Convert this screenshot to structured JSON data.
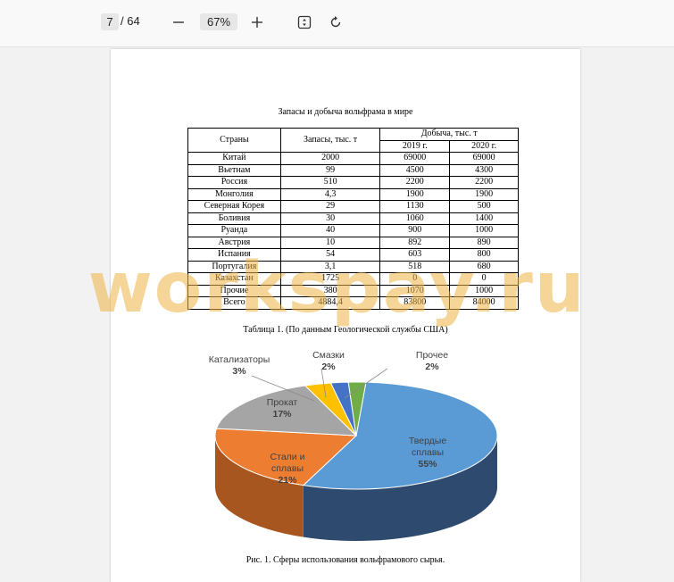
{
  "toolbar": {
    "page_current": "7",
    "page_total": "/ 64",
    "zoom": "67%"
  },
  "document": {
    "table_title": "Запасы и добыча вольфрама в мире",
    "headers": {
      "country": "Страны",
      "reserves": "Запасы, тыс. т",
      "production": "Добыча, тыс. т",
      "y2019": "2019 г.",
      "y2020": "2020 г."
    },
    "rows": [
      {
        "country": "Китай",
        "reserves": "2000",
        "y2019": "69000",
        "y2020": "69000"
      },
      {
        "country": "Вьетнам",
        "reserves": "99",
        "y2019": "4500",
        "y2020": "4300"
      },
      {
        "country": "Россия",
        "reserves": "510",
        "y2019": "2200",
        "y2020": "2200"
      },
      {
        "country": "Монголия",
        "reserves": "4,3",
        "y2019": "1900",
        "y2020": "1900"
      },
      {
        "country": "Северная Корея",
        "reserves": "29",
        "y2019": "1130",
        "y2020": "500"
      },
      {
        "country": "Боливия",
        "reserves": "30",
        "y2019": "1060",
        "y2020": "1400"
      },
      {
        "country": "Руанда",
        "reserves": "40",
        "y2019": "900",
        "y2020": "1000"
      },
      {
        "country": "Австрия",
        "reserves": "10",
        "y2019": "892",
        "y2020": "890"
      },
      {
        "country": "Испания",
        "reserves": "54",
        "y2019": "603",
        "y2020": "800"
      },
      {
        "country": "Португалия",
        "reserves": "3,1",
        "y2019": "518",
        "y2020": "680"
      },
      {
        "country": "Казахстан",
        "reserves": "1725",
        "y2019": "0",
        "y2020": "0"
      },
      {
        "country": "Прочие",
        "reserves": "380",
        "y2019": "1070",
        "y2020": "1000"
      },
      {
        "country": "Всего",
        "reserves": "4884,4",
        "y2019": "83800",
        "y2020": "84000"
      }
    ],
    "table_caption": "Таблица 1. (По данным Геологической службы США)",
    "figure_caption": "Рис. 1. Сферы использования вольфрамового сырья.",
    "watermark": "workspay.ru"
  },
  "chart_data": {
    "type": "pie",
    "style": "3d",
    "slices": [
      {
        "label": "Твердые сплавы",
        "value": 55,
        "pct": "55%",
        "color": "#5b9bd5",
        "side": "#2e4a6e"
      },
      {
        "label": "Стали и сплавы",
        "value": 21,
        "pct": "21%",
        "color": "#ed7d31",
        "side": "#a8561f"
      },
      {
        "label": "Прокат",
        "value": 17,
        "pct": "17%",
        "color": "#a5a5a5",
        "side": "#6e6e6e"
      },
      {
        "label": "Катализаторы",
        "value": 3,
        "pct": "3%",
        "color": "#ffc000",
        "side": "#b38600"
      },
      {
        "label": "Смазки",
        "value": 2,
        "pct": "2%",
        "color": "#4472c4",
        "side": "#2a4a82"
      },
      {
        "label": "Прочее",
        "value": 2,
        "pct": "2%",
        "color": "#70ad47",
        "side": "#4c7a2f"
      }
    ]
  }
}
